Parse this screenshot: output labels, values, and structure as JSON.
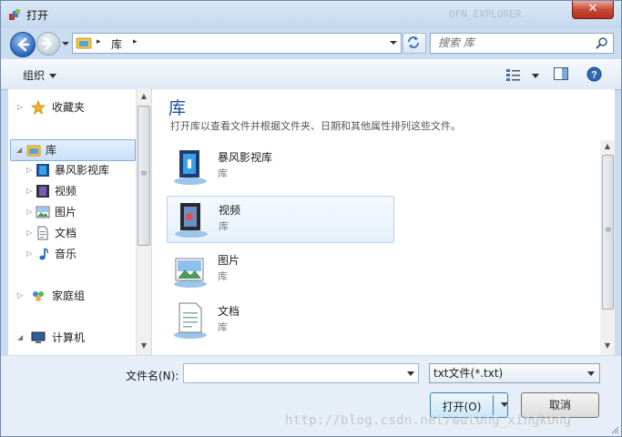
{
  "window": {
    "title": "打开",
    "close_label": "✕",
    "background_text": "OFN_EXPLORER"
  },
  "navbar": {
    "address": {
      "root": "库",
      "separator": "▸"
    },
    "search": {
      "placeholder": "搜索 库"
    }
  },
  "toolbar": {
    "organize_label": "组织"
  },
  "nav_tree": [
    {
      "label": "收藏夹",
      "icon": "star-icon",
      "selected": false
    },
    {
      "label": "库",
      "icon": "library-folder-icon",
      "selected": true
    },
    {
      "label": "暴风影视库",
      "icon": "video-library-icon",
      "selected": false
    },
    {
      "label": "视频",
      "icon": "film-icon",
      "selected": false
    },
    {
      "label": "图片",
      "icon": "picture-icon",
      "selected": false
    },
    {
      "label": "文档",
      "icon": "document-icon",
      "selected": false
    },
    {
      "label": "音乐",
      "icon": "music-note-icon",
      "selected": false
    },
    {
      "label": "家庭组",
      "icon": "homegroup-icon",
      "selected": false
    },
    {
      "label": "计算机",
      "icon": "computer-icon",
      "selected": false
    }
  ],
  "content": {
    "title": "库",
    "subtitle": "打开库以查看文件并根据文件夹、日期和其他属性排列这些文件。",
    "libraries": [
      {
        "name": "暴风影视库",
        "type": "库",
        "icon": "video-library-icon",
        "selected": false
      },
      {
        "name": "视频",
        "type": "库",
        "icon": "video-library-icon",
        "selected": true
      },
      {
        "name": "图片",
        "type": "库",
        "icon": "picture-library-icon",
        "selected": false
      },
      {
        "name": "文档",
        "type": "库",
        "icon": "document-library-icon",
        "selected": false
      }
    ]
  },
  "bottom": {
    "filename_label": "文件名(N):",
    "filename_value": "",
    "filter_value": "txt文件(*.txt)",
    "open_label": "打开(O)",
    "cancel_label": "取消",
    "watermark": "http://blog.csdn.net/wutong_xingkong"
  }
}
